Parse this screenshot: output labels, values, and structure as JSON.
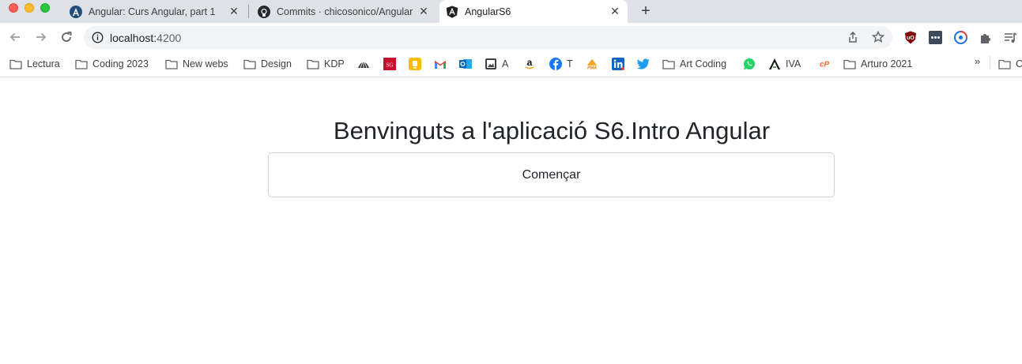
{
  "window": {
    "tabs": [
      {
        "title": "Angular: Curs Angular, part 1",
        "icon": "angular-a-icon",
        "active": false
      },
      {
        "title": "Commits · chicosonico/Angular",
        "icon": "github-icon",
        "active": false
      },
      {
        "title": "AngularS6",
        "icon": "angular-logo-icon",
        "active": true
      }
    ],
    "close_glyph": "✕",
    "new_tab_glyph": "+"
  },
  "toolbar": {
    "url_host": "localhost:",
    "url_port": "4200",
    "extensions": [
      "ublock-icon",
      "dots-extension-icon",
      "sync-icon",
      "puzzle-extensions-icon",
      "reading-list-icon"
    ]
  },
  "bookmarks": {
    "items": [
      {
        "label": "Lectura",
        "icon": "folder-icon"
      },
      {
        "label": "Coding 2023",
        "icon": "folder-icon"
      },
      {
        "label": "New webs",
        "icon": "folder-icon"
      },
      {
        "label": "Design",
        "icon": "folder-icon"
      },
      {
        "label": "KDP",
        "icon": "folder-icon"
      },
      {
        "label": "",
        "icon": "shell-icon"
      },
      {
        "label": "",
        "icon": "sg-icon"
      },
      {
        "label": "",
        "icon": "notes-icon"
      },
      {
        "label": "",
        "icon": "gmail-icon"
      },
      {
        "label": "",
        "icon": "outlook-icon"
      },
      {
        "label": "A",
        "icon": "image-doc-icon"
      },
      {
        "label": "",
        "icon": "amazon-icon"
      },
      {
        "label": "T",
        "icon": "facebook-icon"
      },
      {
        "label": "",
        "icon": "pma-icon"
      },
      {
        "label": "",
        "icon": "linkedin-icon"
      },
      {
        "label": "",
        "icon": "twitter-icon"
      },
      {
        "label": "Art Coding",
        "icon": "folder-icon"
      },
      {
        "label": "",
        "icon": "whatsapp-icon"
      },
      {
        "label": "IVA",
        "icon": "iva-icon"
      },
      {
        "label": "",
        "icon": "cpanel-icon"
      },
      {
        "label": "Arturo 2021",
        "icon": "folder-icon"
      }
    ],
    "overflow_glyph": "»",
    "overflow_folder_label": "C"
  },
  "page": {
    "title": "Benvinguts a l'aplicació S6.Intro Angular",
    "start_button": "Començar"
  },
  "colors": {
    "tabstrip": "#dee1e6",
    "omnibox": "#f1f3f4",
    "text": "#212529",
    "button_border": "#ced4da"
  }
}
